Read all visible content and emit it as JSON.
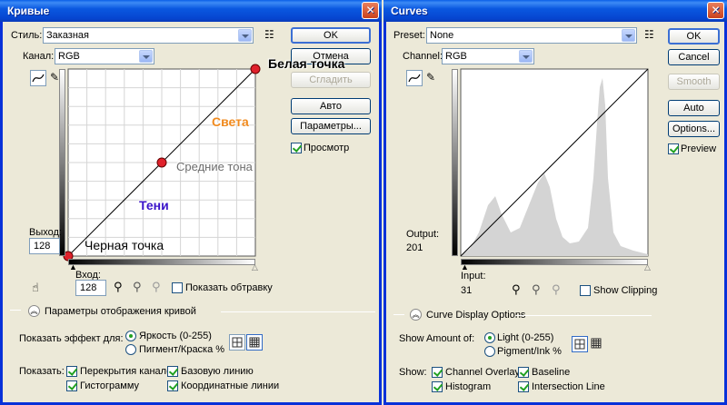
{
  "left": {
    "title": "Кривые",
    "style_label": "Стиль:",
    "style_value": "Заказная",
    "channel_label": "Канал:",
    "channel_value": "RGB",
    "output_label": "Выход:",
    "output_value": "128",
    "input_label": "Вход:",
    "input_value": "128",
    "buttons": {
      "ok": "OK",
      "cancel": "Отмена",
      "smooth": "Сгладить",
      "auto": "Авто",
      "options": "Параметры..."
    },
    "preview_label": "Просмотр",
    "show_clipping_label": "Показать обтравку",
    "display_options_label": "Параметры отображения кривой",
    "show_amount_label": "Показать эффект для:",
    "light_label": "Яркость (0-255)",
    "pigment_label": "Пигмент/Краска %",
    "show_label": "Показать:",
    "overlay_options": {
      "channel_overlays": "Перекрытия каналов",
      "baseline": "Базовую линию",
      "histogram": "Гистограмму",
      "intersection": "Координатные линии"
    },
    "annotations": {
      "white_point": "Белая точка",
      "highlights": "Света",
      "midtones": "Средние тона",
      "shadows": "Тени",
      "black_point": "Черная точка"
    }
  },
  "right": {
    "title": "Curves",
    "preset_label": "Preset:",
    "preset_value": "None",
    "channel_label": "Channel:",
    "channel_value": "RGB",
    "output_label": "Output:",
    "output_value": "201",
    "input_label": "Input:",
    "input_value": "31",
    "buttons": {
      "ok": "OK",
      "cancel": "Cancel",
      "smooth": "Smooth",
      "auto": "Auto",
      "options": "Options..."
    },
    "preview_label": "Preview",
    "show_clipping_label": "Show Clipping",
    "display_options_label": "Curve Display Options",
    "show_amount_label": "Show Amount of:",
    "light_label": "Light  (0-255)",
    "pigment_label": "Pigment/Ink %",
    "show_label": "Show:",
    "overlay_options": {
      "channel_overlays": "Channel Overlays",
      "baseline": "Baseline",
      "histogram": "Histogram",
      "intersection": "Intersection Line"
    }
  },
  "icons": {
    "close": "close-icon",
    "curve_tool": "curve-point-icon",
    "pencil": "pencil-icon",
    "presets_menu": "presets-menu-icon",
    "hand": "on-image-adjust-icon",
    "eyedropper_black": "eyedropper-black-icon",
    "eyedropper_gray": "eyedropper-gray-icon",
    "eyedropper_white": "eyedropper-white-icon",
    "grid_simple": "grid-simple-icon",
    "grid_detailed": "grid-detailed-icon",
    "expand": "chevron-up-icon"
  },
  "colors": {
    "title_bar": "#0a58e0",
    "highlights": "#f08a1e",
    "midtones": "#6d6d6d",
    "shadows": "#3a13c9",
    "control_point": "#e0212b"
  }
}
